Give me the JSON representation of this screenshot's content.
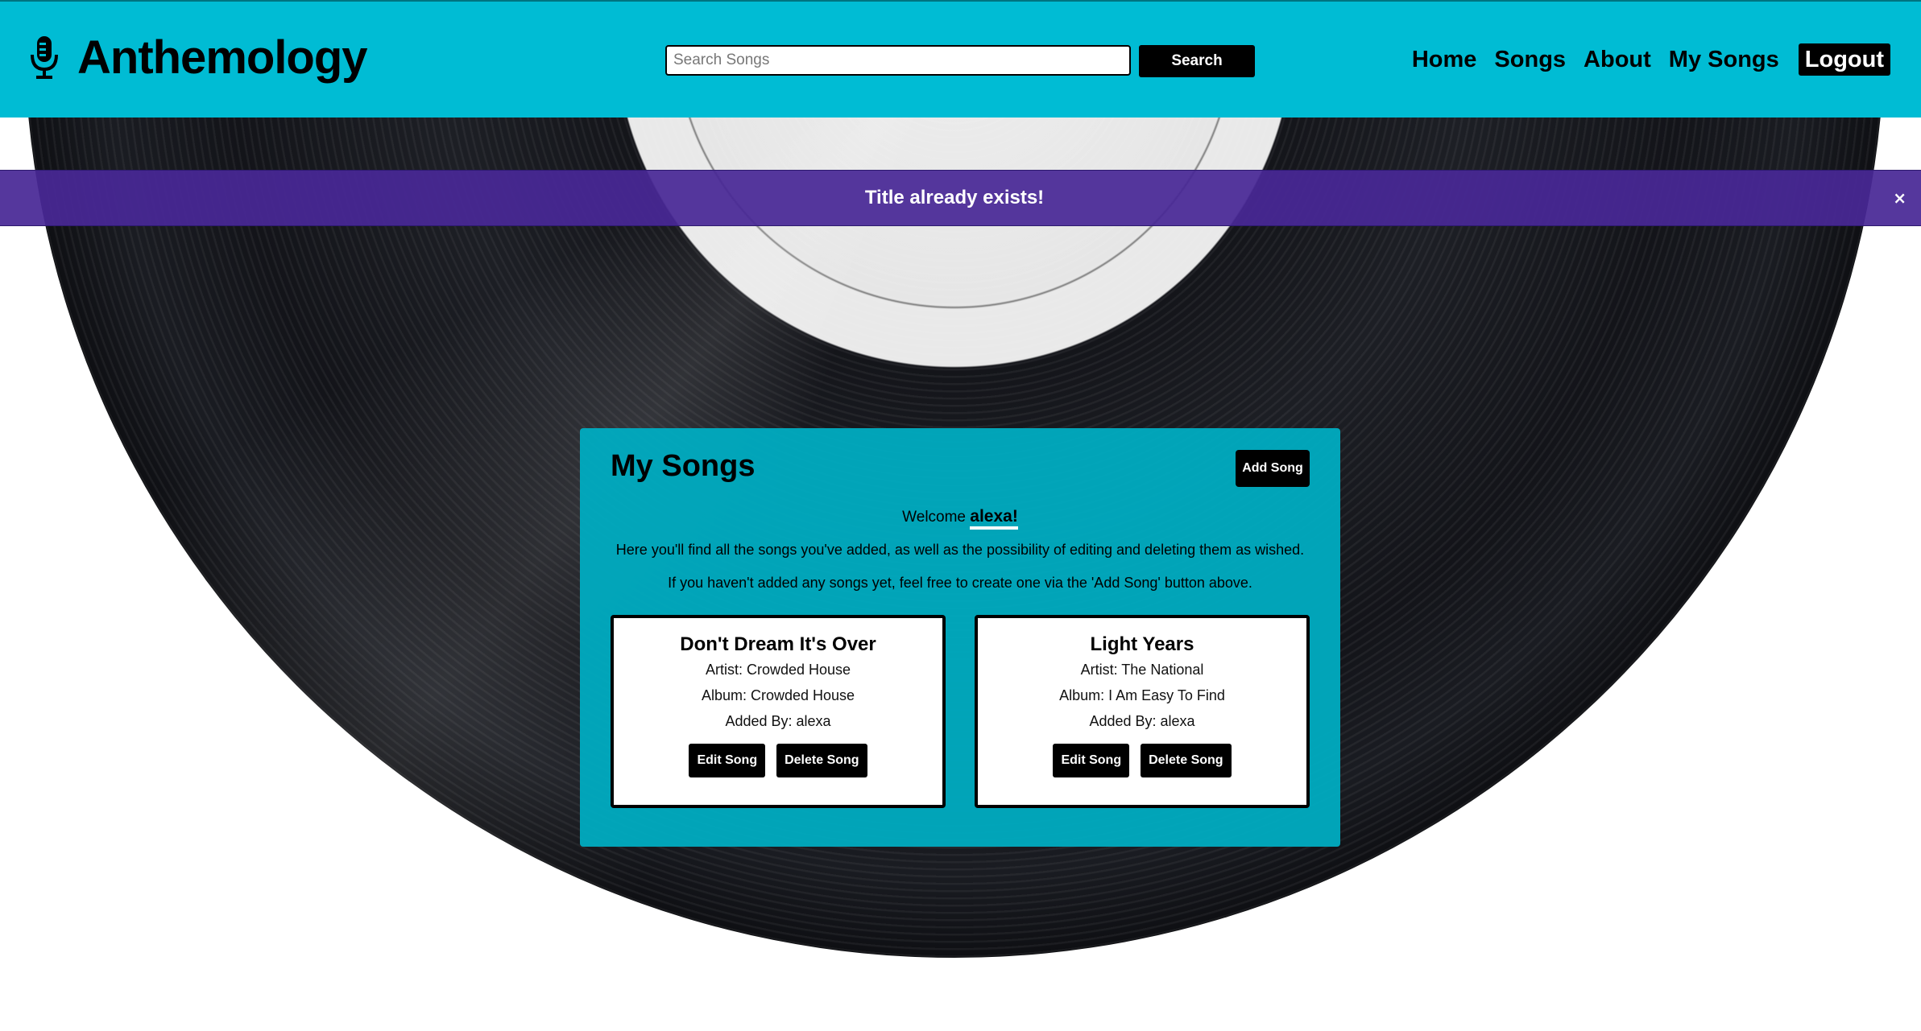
{
  "header": {
    "brand_name": "Anthemology",
    "brand_icon": "microphone-icon",
    "search": {
      "placeholder": "Search Songs",
      "value": "",
      "button_label": "Search"
    },
    "nav": [
      {
        "label": "Home"
      },
      {
        "label": "Songs"
      },
      {
        "label": "About"
      },
      {
        "label": "My Songs"
      },
      {
        "label": "Logout"
      }
    ]
  },
  "alert": {
    "message": "Title already exists!",
    "close_label": "×"
  },
  "my_songs": {
    "title": "My Songs",
    "add_button_label": "Add Song",
    "welcome_prefix": "Welcome",
    "username": "alexa!",
    "intro_1": "Here you'll find all the songs you've added, as well as the possibility of editing and deleting them as wished.",
    "intro_2": "If you haven't added any songs yet, feel free to create one via the 'Add Song' button above.",
    "songs": [
      {
        "title": "Don't Dream It's Over",
        "artist": "Artist: Crowded House",
        "album": "Album: Crowded House",
        "added_by": "Added By: alexa",
        "edit_label": "Edit Song",
        "delete_label": "Delete Song"
      },
      {
        "title": "Light Years",
        "artist": "Artist: The National",
        "album": "Album: I Am Easy To Find",
        "added_by": "Added By: alexa",
        "edit_label": "Edit Song",
        "delete_label": "Delete Song"
      }
    ]
  },
  "colors": {
    "header_bg": "#00bcd4",
    "panel_bg": "#00acc1",
    "alert_bg": "#482896",
    "button_bg": "#000000"
  }
}
